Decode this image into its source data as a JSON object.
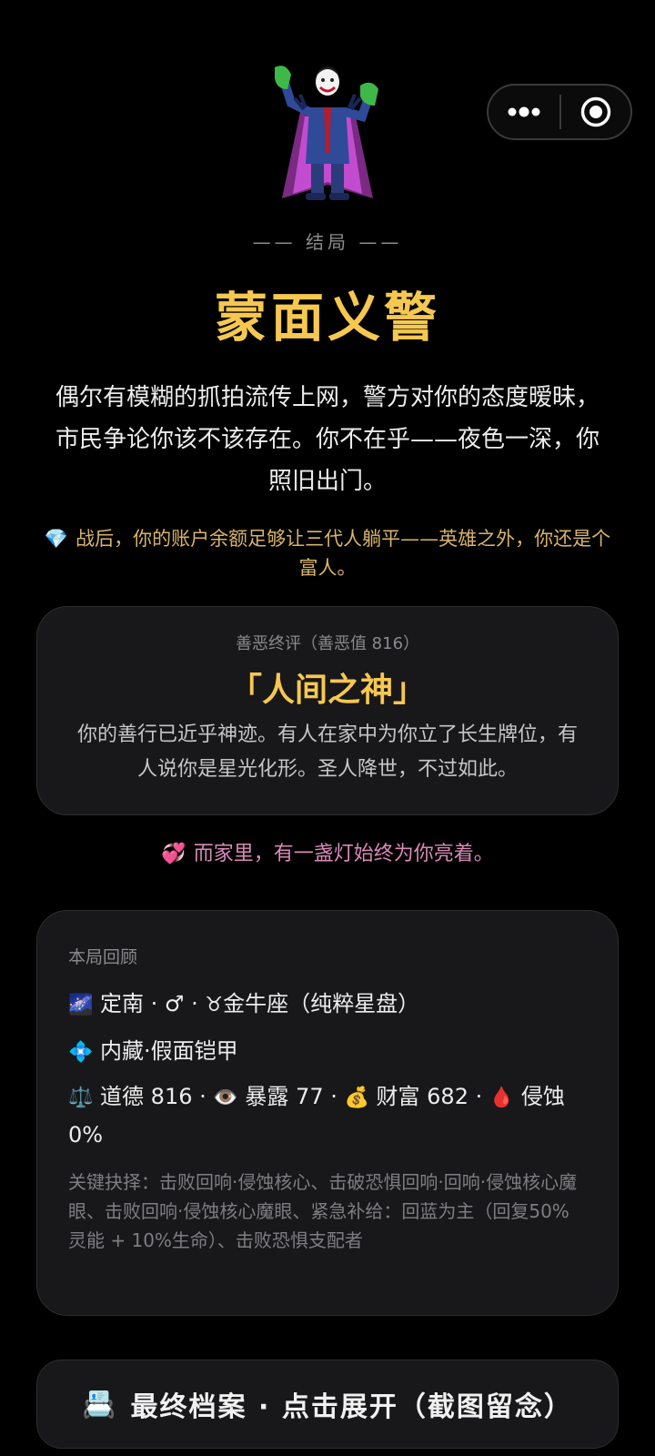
{
  "capsule": {
    "more_icon": "more-dots-icon",
    "close_icon": "target-icon"
  },
  "hero": {
    "icon": "joker-villain-emoji"
  },
  "ending_label": "—— 结局 ——",
  "title": "蒙面义警",
  "story": "偶尔有模糊的抓拍流传上网，警方对你的态度暧昧，市民争论你该不该存在。你不在乎——夜色一深，你照旧出门。",
  "wealth": {
    "icon": "💎",
    "text": "战后，你的账户余额足够让三代人躺平——英雄之外，你还是个富人。"
  },
  "verdict": {
    "header": "善恶终评（善恶值 816）",
    "title": "「人间之神」",
    "body": "你的善行已近乎神迹。有人在家中为你立了长生牌位，有人说你是星光化形。圣人降世，不过如此。"
  },
  "home": {
    "icon": "💞",
    "text": "而家里，有一盏灯始终为你亮着。"
  },
  "review": {
    "title": "本局回顾",
    "line1": {
      "icon1": "🌌",
      "text1": "定南 · ♂ · ",
      "icon2": "♉",
      "text2": "金牛座（纯粹星盘）"
    },
    "line2": {
      "icon": "💠",
      "text": "内藏·假面铠甲"
    },
    "line3": {
      "icon_morality": "⚖️",
      "morality": "道德 816",
      "icon_exposure": "👁️",
      "exposure": "暴露 77",
      "icon_wealth": "💰",
      "wealth": "财富 682",
      "icon_corrosion": "🩸",
      "corrosion": "侵蚀 0%",
      "sep": " · "
    },
    "key_choices": "关键抉择：击败回响·侵蚀核心、击破恐惧回响·回响·侵蚀核心魔眼、击败回响·侵蚀核心魔眼、紧急补给：回蓝为主（回复50%灵能 + 10%生命）、击败恐惧支配者"
  },
  "archive": {
    "icon": "📇",
    "label": "最终档案 · 点击展开（截图留念）"
  },
  "colors": {
    "gold": "#f6c850",
    "pink": "#d88ab8",
    "tan": "#d8b46a",
    "card_bg": "#18181a"
  }
}
